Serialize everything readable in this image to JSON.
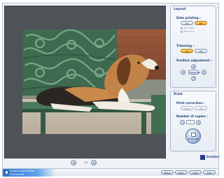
{
  "layout_panel": {
    "title": "Layout",
    "date_printing": {
      "label": "Date printing :",
      "on_label": "On",
      "off_label": "Off",
      "options": [
        "Print date",
        "Print time"
      ]
    },
    "trimming": {
      "label": "Trimming :",
      "on_label": "On",
      "off_label": "Off"
    },
    "position_adjustment": {
      "label": "Position adjustment :",
      "center_label": "Centering"
    }
  },
  "print_panel": {
    "title": "Print",
    "print_correction": {
      "label": "Print correction :",
      "option_a": "Auto",
      "option_b": "Off"
    },
    "copies": {
      "label": "Number of copies :",
      "value": "1"
    },
    "print_button_label": "Print all"
  },
  "navigation": {
    "prev": "◂",
    "next": "▸",
    "page": "1/1"
  },
  "brand": {
    "logo_text": "brother"
  },
  "status": {
    "line1": "Custom Simple Viewer",
    "line2": "Print preview"
  },
  "footer_buttons": [
    "Menu",
    "Back",
    "Help",
    "Exit"
  ],
  "colors": {
    "accent": "#1c3f78",
    "toggle_on": "#f1a628",
    "preview_bg": "#4e5358"
  }
}
